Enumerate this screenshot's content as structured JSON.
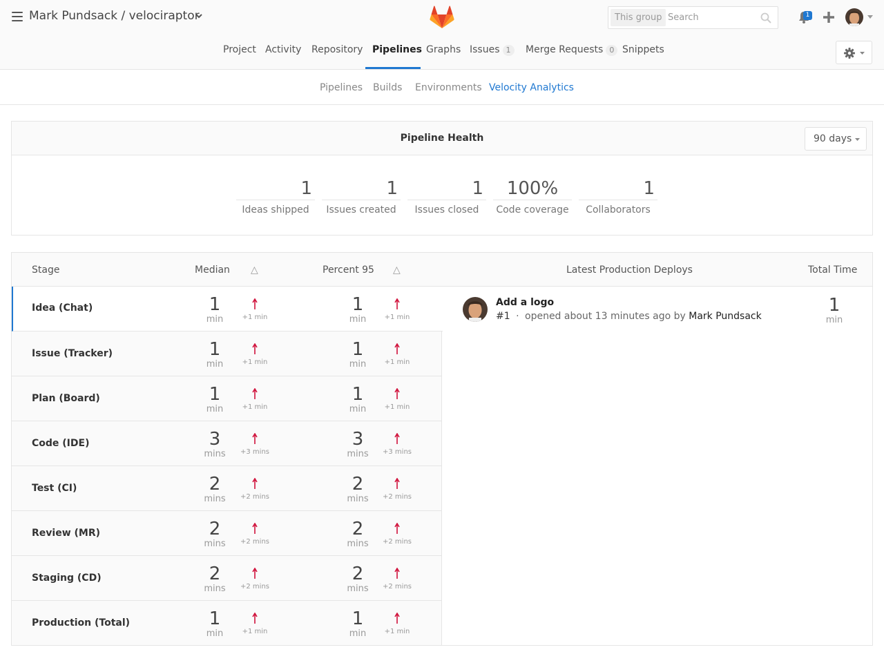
{
  "header": {
    "breadcrumb": "Mark Pundsack / velociraptor",
    "search_scope": "This group",
    "search_placeholder": "Search",
    "notification_count": "1"
  },
  "nav": {
    "items": [
      {
        "label": "Project"
      },
      {
        "label": "Activity"
      },
      {
        "label": "Repository"
      },
      {
        "label": "Pipelines"
      },
      {
        "label": "Graphs"
      },
      {
        "label": "Issues",
        "count": "1"
      },
      {
        "label": "Merge Requests",
        "count": "0"
      },
      {
        "label": "Snippets"
      }
    ],
    "active": "Pipelines"
  },
  "subnav": {
    "items": [
      {
        "label": "Pipelines"
      },
      {
        "label": "Builds"
      },
      {
        "label": "Environments"
      },
      {
        "label": "Velocity Analytics"
      }
    ],
    "active": "Velocity Analytics"
  },
  "health": {
    "title": "Pipeline Health",
    "range_label": "90 days",
    "stats": [
      {
        "value": "1",
        "label": "Ideas shipped"
      },
      {
        "value": "1",
        "label": "Issues created"
      },
      {
        "value": "1",
        "label": "Issues closed"
      },
      {
        "value": "100%",
        "label": "Code coverage"
      },
      {
        "value": "1",
        "label": "Collaborators"
      }
    ]
  },
  "table": {
    "headers": {
      "stage": "Stage",
      "median": "Median",
      "median_delta": "△",
      "p95": "Percent 95",
      "p95_delta": "△",
      "deploys": "Latest Production Deploys",
      "total": "Total Time"
    },
    "rows": [
      {
        "stage": "Idea (Chat)",
        "median": "1",
        "median_unit": "min",
        "median_delta": "+1 min",
        "p95": "1",
        "p95_unit": "min",
        "p95_delta": "+1 min"
      },
      {
        "stage": "Issue (Tracker)",
        "median": "1",
        "median_unit": "min",
        "median_delta": "+1 min",
        "p95": "1",
        "p95_unit": "min",
        "p95_delta": "+1 min"
      },
      {
        "stage": "Plan (Board)",
        "median": "1",
        "median_unit": "min",
        "median_delta": "+1 min",
        "p95": "1",
        "p95_unit": "min",
        "p95_delta": "+1 min"
      },
      {
        "stage": "Code (IDE)",
        "median": "3",
        "median_unit": "mins",
        "median_delta": "+3 mins",
        "p95": "3",
        "p95_unit": "mins",
        "p95_delta": "+3 mins"
      },
      {
        "stage": "Test (CI)",
        "median": "2",
        "median_unit": "mins",
        "median_delta": "+2 mins",
        "p95": "2",
        "p95_unit": "mins",
        "p95_delta": "+2 mins"
      },
      {
        "stage": "Review (MR)",
        "median": "2",
        "median_unit": "mins",
        "median_delta": "+2 mins",
        "p95": "2",
        "p95_unit": "mins",
        "p95_delta": "+2 mins"
      },
      {
        "stage": "Staging (CD)",
        "median": "2",
        "median_unit": "mins",
        "median_delta": "+2 mins",
        "p95": "2",
        "p95_unit": "mins",
        "p95_delta": "+2 mins"
      },
      {
        "stage": "Production (Total)",
        "median": "1",
        "median_unit": "min",
        "median_delta": "+1 min",
        "p95": "1",
        "p95_unit": "min",
        "p95_delta": "+1 min"
      }
    ],
    "deploy": {
      "title": "Add a logo",
      "number": "#1",
      "separator": "·",
      "meta": "opened about 13 minutes ago by",
      "author": "Mark Pundsack"
    },
    "total": {
      "value": "1",
      "unit": "min"
    }
  },
  "colors": {
    "accent": "#1f78d1",
    "increase": "#d0103a"
  }
}
